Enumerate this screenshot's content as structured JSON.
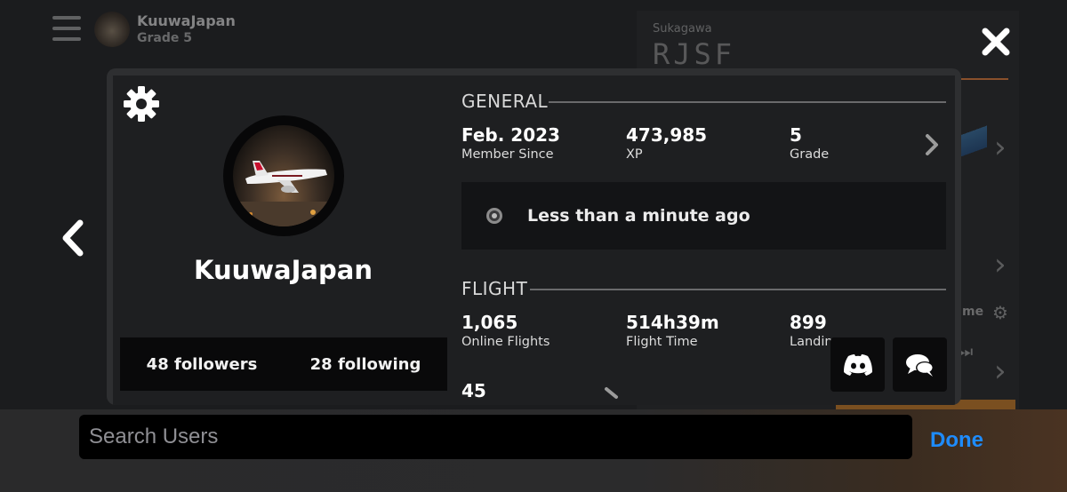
{
  "background": {
    "user_name": "KuuwaJapan",
    "user_grade": "Grade 5",
    "airport_name": "Sukagawa",
    "airport_code": "RJSF",
    "partial_text": "me"
  },
  "profile": {
    "name": "KuuwaJapan",
    "followers": "48 followers",
    "following": "28 following"
  },
  "general": {
    "title": "GENERAL",
    "stats": [
      {
        "value": "Feb. 2023",
        "label": "Member Since"
      },
      {
        "value": "473,985",
        "label": "XP"
      },
      {
        "value": "5",
        "label": "Grade"
      }
    ],
    "status": "Less than a minute ago"
  },
  "flight": {
    "title": "FLIGHT",
    "stats": [
      {
        "value": "1,065",
        "label": "Online Flights"
      },
      {
        "value": "514h39m",
        "label": "Flight Time"
      },
      {
        "value": "899",
        "label": "Landin"
      },
      {
        "value": "45",
        "label": ""
      }
    ]
  },
  "icons": {
    "close": "close-icon",
    "back": "chevron-left-icon",
    "settings": "gear-icon",
    "discord": "discord-icon",
    "chat": "chat-bubbles-icon"
  },
  "search": {
    "placeholder": "Search Users",
    "value": "",
    "done_label": "Done"
  },
  "colors": {
    "accent_blue": "#1e8cff",
    "modal_bg": "#1e1f21",
    "page_bg": "#1b1c1e"
  }
}
